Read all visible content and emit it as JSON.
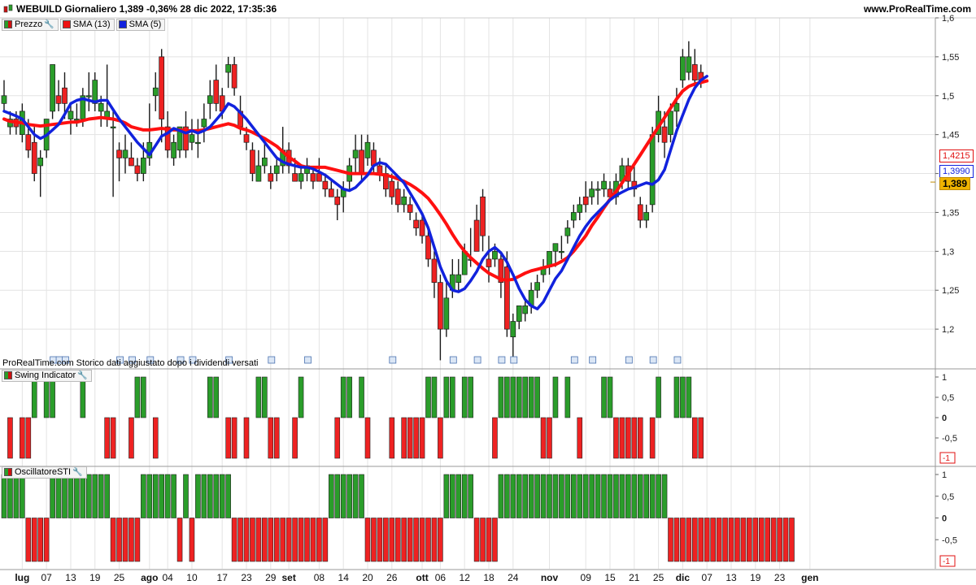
{
  "header": {
    "title": "WEBUILD Giornaliero 1,389 -0,36% 28 dic 2022, 17:35:36",
    "site": "www.ProRealTime.com"
  },
  "legend_price": [
    {
      "label": "Prezzo",
      "color": "#cc1111"
    },
    {
      "label": "SMA (13)",
      "color": "#ee1111"
    },
    {
      "label": "SMA (5)",
      "color": "#1122dd"
    }
  ],
  "legend_swing": "Swing Indicator",
  "legend_osc": "OscillatoreSTI",
  "note": "ProRealTime.com Storico dati aggiustato dopo i dividendi versati",
  "price_boxes": {
    "sma13": "1,4215",
    "sma5": "1,3990",
    "last": "1,389"
  },
  "colors": {
    "up": "#2a9d2a",
    "down": "#ee2222",
    "sma13": "#ff1010",
    "sma5": "#1122dd"
  },
  "chart_data": [
    {
      "type": "candlestick",
      "ylim": [
        1.15,
        1.6
      ],
      "yticks": [
        "1,6",
        "1,55",
        "1,5",
        "1,45",
        "1,4",
        "1,35",
        "1,3",
        "1,25",
        "1,2"
      ],
      "ytick_values": [
        1.6,
        1.55,
        1.5,
        1.45,
        1.4,
        1.35,
        1.3,
        1.25,
        1.2
      ],
      "xticks": [
        {
          "label": "lug",
          "bold": true,
          "i": 3
        },
        {
          "label": "07",
          "i": 7
        },
        {
          "label": "13",
          "i": 11
        },
        {
          "label": "19",
          "i": 15
        },
        {
          "label": "25",
          "i": 19
        },
        {
          "label": "ago",
          "bold": true,
          "i": 24
        },
        {
          "label": "04",
          "i": 27
        },
        {
          "label": "10",
          "i": 31
        },
        {
          "label": "17",
          "i": 36
        },
        {
          "label": "23",
          "i": 40
        },
        {
          "label": "29",
          "i": 44
        },
        {
          "label": "set",
          "bold": true,
          "i": 47
        },
        {
          "label": "08",
          "i": 52
        },
        {
          "label": "14",
          "i": 56
        },
        {
          "label": "20",
          "i": 60
        },
        {
          "label": "26",
          "i": 64
        },
        {
          "label": "ott",
          "bold": true,
          "i": 69
        },
        {
          "label": "06",
          "i": 72
        },
        {
          "label": "12",
          "i": 76
        },
        {
          "label": "18",
          "i": 80
        },
        {
          "label": "24",
          "i": 84
        },
        {
          "label": "nov",
          "bold": true,
          "i": 90
        },
        {
          "label": "09",
          "i": 96
        },
        {
          "label": "15",
          "i": 100
        },
        {
          "label": "21",
          "i": 104
        },
        {
          "label": "25",
          "i": 108
        },
        {
          "label": "dic",
          "bold": true,
          "i": 112
        },
        {
          "label": "07",
          "i": 116
        },
        {
          "label": "13",
          "i": 120
        },
        {
          "label": "19",
          "i": 124
        },
        {
          "label": "23",
          "i": 128
        },
        {
          "label": "gen",
          "bold": true,
          "i": 133
        }
      ],
      "candles": [
        [
          1.49,
          1.52,
          1.48,
          1.5
        ],
        [
          1.46,
          1.48,
          1.45,
          1.47
        ],
        [
          1.47,
          1.48,
          1.45,
          1.46
        ],
        [
          1.45,
          1.49,
          1.44,
          1.48
        ],
        [
          1.45,
          1.47,
          1.42,
          1.43
        ],
        [
          1.44,
          1.46,
          1.39,
          1.4
        ],
        [
          1.41,
          1.43,
          1.37,
          1.42
        ],
        [
          1.43,
          1.47,
          1.42,
          1.47
        ],
        [
          1.48,
          1.54,
          1.47,
          1.54
        ],
        [
          1.5,
          1.52,
          1.48,
          1.49
        ],
        [
          1.51,
          1.53,
          1.47,
          1.49
        ],
        [
          1.47,
          1.49,
          1.45,
          1.48
        ],
        [
          1.47,
          1.49,
          1.46,
          1.47
        ],
        [
          1.47,
          1.51,
          1.46,
          1.5
        ],
        [
          1.5,
          1.53,
          1.48,
          1.5
        ],
        [
          1.49,
          1.53,
          1.48,
          1.52
        ],
        [
          1.48,
          1.5,
          1.46,
          1.49
        ],
        [
          1.47,
          1.54,
          1.46,
          1.48
        ],
        [
          1.46,
          1.48,
          1.37,
          1.46
        ],
        [
          1.43,
          1.44,
          1.39,
          1.42
        ],
        [
          1.42,
          1.45,
          1.4,
          1.43
        ],
        [
          1.42,
          1.44,
          1.41,
          1.41
        ],
        [
          1.41,
          1.42,
          1.39,
          1.4
        ],
        [
          1.4,
          1.44,
          1.39,
          1.42
        ],
        [
          1.42,
          1.49,
          1.41,
          1.44
        ],
        [
          1.5,
          1.53,
          1.48,
          1.51
        ],
        [
          1.55,
          1.56,
          1.44,
          1.47
        ],
        [
          1.46,
          1.48,
          1.42,
          1.43
        ],
        [
          1.42,
          1.45,
          1.41,
          1.44
        ],
        [
          1.43,
          1.46,
          1.42,
          1.46
        ],
        [
          1.46,
          1.48,
          1.42,
          1.43
        ],
        [
          1.44,
          1.47,
          1.43,
          1.45
        ],
        [
          1.44,
          1.47,
          1.42,
          1.44
        ],
        [
          1.46,
          1.49,
          1.44,
          1.47
        ],
        [
          1.49,
          1.52,
          1.47,
          1.5
        ],
        [
          1.52,
          1.54,
          1.48,
          1.49
        ],
        [
          1.5,
          1.51,
          1.47,
          1.48
        ],
        [
          1.53,
          1.55,
          1.51,
          1.54
        ],
        [
          1.54,
          1.55,
          1.5,
          1.51
        ],
        [
          1.48,
          1.5,
          1.45,
          1.46
        ],
        [
          1.45,
          1.46,
          1.43,
          1.44
        ],
        [
          1.43,
          1.44,
          1.39,
          1.4
        ],
        [
          1.39,
          1.43,
          1.39,
          1.41
        ],
        [
          1.41,
          1.44,
          1.4,
          1.42
        ],
        [
          1.4,
          1.41,
          1.38,
          1.39
        ],
        [
          1.4,
          1.42,
          1.39,
          1.41
        ],
        [
          1.41,
          1.46,
          1.4,
          1.43
        ],
        [
          1.43,
          1.44,
          1.4,
          1.41
        ],
        [
          1.4,
          1.42,
          1.39,
          1.39
        ],
        [
          1.39,
          1.41,
          1.38,
          1.4
        ],
        [
          1.4,
          1.42,
          1.39,
          1.41
        ],
        [
          1.4,
          1.41,
          1.38,
          1.39
        ],
        [
          1.4,
          1.42,
          1.39,
          1.39
        ],
        [
          1.39,
          1.4,
          1.37,
          1.38
        ],
        [
          1.38,
          1.39,
          1.37,
          1.37
        ],
        [
          1.37,
          1.38,
          1.34,
          1.36
        ],
        [
          1.37,
          1.39,
          1.35,
          1.38
        ],
        [
          1.39,
          1.42,
          1.38,
          1.41
        ],
        [
          1.42,
          1.45,
          1.4,
          1.43
        ],
        [
          1.43,
          1.45,
          1.39,
          1.4
        ],
        [
          1.42,
          1.45,
          1.41,
          1.44
        ],
        [
          1.43,
          1.44,
          1.4,
          1.41
        ],
        [
          1.41,
          1.42,
          1.39,
          1.4
        ],
        [
          1.4,
          1.41,
          1.37,
          1.38
        ],
        [
          1.39,
          1.4,
          1.36,
          1.37
        ],
        [
          1.38,
          1.39,
          1.35,
          1.36
        ],
        [
          1.36,
          1.38,
          1.35,
          1.37
        ],
        [
          1.36,
          1.37,
          1.34,
          1.35
        ],
        [
          1.34,
          1.35,
          1.32,
          1.33
        ],
        [
          1.34,
          1.35,
          1.31,
          1.32
        ],
        [
          1.32,
          1.33,
          1.28,
          1.29
        ],
        [
          1.29,
          1.3,
          1.24,
          1.26
        ],
        [
          1.26,
          1.27,
          1.16,
          1.2
        ],
        [
          1.2,
          1.26,
          1.19,
          1.24
        ],
        [
          1.25,
          1.29,
          1.24,
          1.27
        ],
        [
          1.26,
          1.29,
          1.25,
          1.27
        ],
        [
          1.27,
          1.31,
          1.27,
          1.3
        ],
        [
          1.29,
          1.33,
          1.28,
          1.29
        ],
        [
          1.34,
          1.36,
          1.3,
          1.3
        ],
        [
          1.37,
          1.38,
          1.3,
          1.32
        ],
        [
          1.29,
          1.32,
          1.26,
          1.28
        ],
        [
          1.29,
          1.31,
          1.28,
          1.3
        ],
        [
          1.29,
          1.3,
          1.24,
          1.26
        ],
        [
          1.28,
          1.3,
          1.19,
          1.2
        ],
        [
          1.19,
          1.22,
          1.16,
          1.21
        ],
        [
          1.21,
          1.23,
          1.2,
          1.23
        ],
        [
          1.22,
          1.24,
          1.21,
          1.23
        ],
        [
          1.23,
          1.26,
          1.22,
          1.25
        ],
        [
          1.25,
          1.27,
          1.24,
          1.26
        ],
        [
          1.27,
          1.29,
          1.26,
          1.28
        ],
        [
          1.28,
          1.3,
          1.27,
          1.3
        ],
        [
          1.3,
          1.31,
          1.28,
          1.31
        ],
        [
          1.3,
          1.32,
          1.29,
          1.3
        ],
        [
          1.32,
          1.34,
          1.31,
          1.33
        ],
        [
          1.34,
          1.36,
          1.33,
          1.35
        ],
        [
          1.35,
          1.37,
          1.34,
          1.36
        ],
        [
          1.37,
          1.39,
          1.35,
          1.36
        ],
        [
          1.37,
          1.39,
          1.36,
          1.38
        ],
        [
          1.38,
          1.39,
          1.36,
          1.38
        ],
        [
          1.38,
          1.4,
          1.37,
          1.39
        ],
        [
          1.38,
          1.39,
          1.37,
          1.37
        ],
        [
          1.37,
          1.4,
          1.36,
          1.39
        ],
        [
          1.39,
          1.42,
          1.38,
          1.41
        ],
        [
          1.41,
          1.42,
          1.38,
          1.39
        ],
        [
          1.39,
          1.41,
          1.37,
          1.38
        ],
        [
          1.36,
          1.37,
          1.33,
          1.34
        ],
        [
          1.34,
          1.36,
          1.33,
          1.35
        ],
        [
          1.36,
          1.46,
          1.35,
          1.45
        ],
        [
          1.45,
          1.5,
          1.44,
          1.48
        ],
        [
          1.46,
          1.48,
          1.42,
          1.44
        ],
        [
          1.45,
          1.49,
          1.44,
          1.48
        ],
        [
          1.48,
          1.51,
          1.46,
          1.49
        ],
        [
          1.52,
          1.56,
          1.51,
          1.55
        ],
        [
          1.53,
          1.57,
          1.52,
          1.55
        ],
        [
          1.54,
          1.56,
          1.51,
          1.52
        ],
        [
          1.53,
          1.54,
          1.51,
          1.52
        ]
      ],
      "sma13": [
        1.47,
        1.467,
        1.466,
        1.465,
        1.463,
        1.462,
        1.461,
        1.462,
        1.463,
        1.464,
        1.465,
        1.466,
        1.466,
        1.468,
        1.47,
        1.471,
        1.472,
        1.471,
        1.47,
        1.468,
        1.465,
        1.46,
        1.458,
        1.456,
        1.456,
        1.457,
        1.458,
        1.457,
        1.456,
        1.456,
        1.455,
        1.455,
        1.455,
        1.456,
        1.458,
        1.46,
        1.462,
        1.464,
        1.462,
        1.458,
        1.456,
        1.453,
        1.449,
        1.445,
        1.44,
        1.435,
        1.428,
        1.421,
        1.416,
        1.41,
        1.408,
        1.408,
        1.408,
        1.408,
        1.406,
        1.404,
        1.402,
        1.4,
        1.4,
        1.4,
        1.4,
        1.4,
        1.399,
        1.398,
        1.396,
        1.393,
        1.39,
        1.386,
        1.381,
        1.375,
        1.368,
        1.358,
        1.347,
        1.335,
        1.322,
        1.31,
        1.3,
        1.292,
        1.285,
        1.278,
        1.272,
        1.268,
        1.264,
        1.263,
        1.264,
        1.268,
        1.272,
        1.275,
        1.277,
        1.279,
        1.281,
        1.283,
        1.287,
        1.292,
        1.3,
        1.31,
        1.32,
        1.333,
        1.344,
        1.356,
        1.367,
        1.377,
        1.388,
        1.4,
        1.412,
        1.424,
        1.436,
        1.448,
        1.46,
        1.472,
        1.484,
        1.496,
        1.506,
        1.512,
        1.515,
        1.517,
        1.519
      ],
      "sma5": [
        1.48,
        1.477,
        1.474,
        1.47,
        1.46,
        1.45,
        1.445,
        1.449,
        1.456,
        1.463,
        1.476,
        1.49,
        1.494,
        1.496,
        1.494,
        1.492,
        1.494,
        1.494,
        1.482,
        1.47,
        1.46,
        1.45,
        1.44,
        1.432,
        1.424,
        1.436,
        1.448,
        1.452,
        1.458,
        1.455,
        1.452,
        1.455,
        1.452,
        1.455,
        1.46,
        1.469,
        1.478,
        1.49,
        1.486,
        1.478,
        1.47,
        1.46,
        1.45,
        1.44,
        1.43,
        1.42,
        1.415,
        1.412,
        1.41,
        1.408,
        1.408,
        1.406,
        1.402,
        1.398,
        1.392,
        1.386,
        1.38,
        1.378,
        1.382,
        1.39,
        1.398,
        1.41,
        1.414,
        1.412,
        1.404,
        1.396,
        1.388,
        1.375,
        1.362,
        1.348,
        1.33,
        1.305,
        1.28,
        1.262,
        1.25,
        1.248,
        1.252,
        1.262,
        1.274,
        1.29,
        1.3,
        1.305,
        1.298,
        1.286,
        1.27,
        1.252,
        1.238,
        1.23,
        1.226,
        1.235,
        1.25,
        1.265,
        1.275,
        1.29,
        1.305,
        1.32,
        1.332,
        1.342,
        1.35,
        1.358,
        1.366,
        1.372,
        1.376,
        1.38,
        1.382,
        1.385,
        1.388,
        1.386,
        1.392,
        1.405,
        1.43,
        1.455,
        1.475,
        1.495,
        1.51,
        1.52,
        1.525
      ],
      "last_price": 1.389
    },
    {
      "type": "bar",
      "name": "Swing Indicator",
      "yticks": [
        "1",
        "0,5",
        "0",
        "-0,5"
      ],
      "yticks_bottom_box": "-1",
      "values": [
        0,
        -1,
        0,
        -1,
        -1,
        1,
        0,
        1,
        1,
        0,
        0,
        0,
        0,
        1,
        0,
        0,
        0,
        -1,
        -1,
        0,
        0,
        -1,
        1,
        1,
        0,
        -1,
        0,
        0,
        0,
        0,
        0,
        0,
        0,
        0,
        1,
        1,
        0,
        -1,
        -1,
        0,
        -1,
        0,
        1,
        1,
        -1,
        -1,
        0,
        0,
        -1,
        1,
        0,
        0,
        0,
        0,
        0,
        -1,
        1,
        1,
        0,
        1,
        -1,
        0,
        0,
        0,
        -1,
        0,
        -1,
        -1,
        -1,
        -1,
        1,
        1,
        -1,
        1,
        1,
        0,
        1,
        1,
        0,
        0,
        0,
        -1,
        1,
        1,
        1,
        1,
        1,
        1,
        1,
        -1,
        -1,
        1,
        0,
        1,
        0,
        -1,
        0,
        0,
        0,
        1,
        1,
        -1,
        -1,
        -1,
        -1,
        -1,
        0,
        -1,
        1,
        0,
        0,
        1,
        1,
        1,
        -1,
        -1
      ]
    },
    {
      "type": "bar",
      "name": "OscillatoreSTI",
      "yticks": [
        "1",
        "0,5",
        "0",
        "-0,5"
      ],
      "yticks_bottom_box": "-1",
      "values": [
        1,
        1,
        1,
        1,
        -1,
        -1,
        -1,
        -1,
        1,
        1,
        1,
        1,
        1,
        1,
        1,
        1,
        1,
        1,
        -1,
        -1,
        -1,
        -1,
        -1,
        1,
        1,
        1,
        1,
        1,
        1,
        -1,
        1,
        -1,
        1,
        1,
        1,
        1,
        1,
        1,
        -1,
        -1,
        -1,
        -1,
        -1,
        -1,
        -1,
        -1,
        -1,
        -1,
        -1,
        -1,
        -1,
        -1,
        -1,
        -1,
        1,
        1,
        1,
        1,
        1,
        1,
        -1,
        -1,
        -1,
        -1,
        -1,
        -1,
        -1,
        -1,
        -1,
        -1,
        -1,
        -1,
        -1,
        1,
        1,
        1,
        1,
        1,
        -1,
        -1,
        -1,
        -1,
        1,
        1,
        1,
        1,
        1,
        1,
        1,
        1,
        1,
        1,
        1,
        1,
        1,
        1,
        1,
        1,
        1,
        1,
        1,
        1,
        1,
        1,
        1,
        1,
        1,
        1,
        1,
        1,
        -1,
        -1,
        -1,
        -1,
        -1,
        -1,
        -1,
        -1,
        -1,
        -1,
        -1,
        -1,
        -1,
        -1,
        -1,
        -1,
        -1,
        -1,
        -1,
        -1,
        -1
      ]
    }
  ]
}
